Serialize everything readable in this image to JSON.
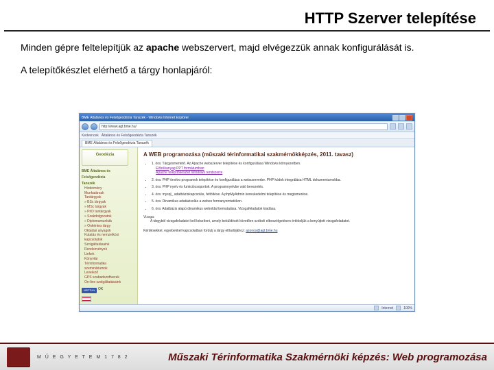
{
  "title": "HTTP Szerver telepítése",
  "para1_pre": "Minden gépre feltelepítjük az ",
  "para1_bold": "apache",
  "para1_post": " webszervert, majd elvégezzük annak konfigurálását is.",
  "para2": "A telepítőkészlet elérhető a tárgy honlapjáról:",
  "browser": {
    "window_title": "BME Általános és Felsőgeodézia Tanszék - Windows Internet Explorer",
    "address": "http://www.agt.bme.hu/",
    "tab_label": "BME Általános és Felsőgeodézia Tanszék",
    "linkbar": {
      "a": "Kedvencek",
      "b": "Általános és Felsőgeodézia Tanszék"
    },
    "sidebar": {
      "logo_top": "Geodézia",
      "head1": "BME Általános és",
      "head2": "Felsőgeodézia",
      "head3": "Tanszék",
      "menu1": "Hirdetmény",
      "menu2": "Munkatársak",
      "menu3": "Tantárgyak",
      "m3a": "» BSc tárgyak",
      "m3b": "» MSc tárgyak",
      "m3c": "» PhD tantárgyak",
      "m3d": "» Szakdolgozatok",
      "m3e": "» Diplomamunkák",
      "m3f": "» Önkéntes tárgy",
      "menu4": "Oktatási anyagok",
      "menu5": "Kutatás és nemzetközi",
      "menu6": "kapcsolatok",
      "menu7": "Szolgáltatásaink",
      "menu8": "Rendezvények",
      "menu9": "Linkek",
      "menu10": "Könyvtár",
      "menu11": "Térinformatika",
      "menu12": "szemináriumok",
      "menu13": "Levelező",
      "menu14": "GPS szabadszoftverek",
      "menu15": "On-line szolgáltatásaink",
      "badge": "NEPTUN",
      "ok": "OK"
    },
    "page": {
      "heading": "A WEB programozása (műszaki térinformatikai szakmérnökképzés, 2011. tavasz)",
      "li1": "1. óra: Tárgyismertető. Az Apache webszerver telepítése és konfigurálása Windows környezetben.",
      "li1a": "Előzékanyag PPT formátumban",
      "li1b": "Apache telepítőkészlet Windows rendszerre",
      "li2": "2. óra: PHP önvitro programok telepítése és konfigurálása a webszerverbe. PHP kódok integrálása HTML dokumentumokba.",
      "li3": "3. óra: PHP nyelv és funkciócsoportok. A programnyelvbe való bevezetés.",
      "li4": "4. óra: mysql_ adatbáziskapcsolás, feltöltése. A phpMyAdmin kereskedelmi telepítése és megismerése.",
      "li5": "5. óra: Dinamikus adatázisolás a webes formanyomtatókon.",
      "li6": "6. óra: Adatbázis alapú dinamikus weboldal bemutatása. Vizsgafeladatok kiadása.",
      "vizsga": "Vizsga:",
      "vizsga_detail": "A tárgyból vizsgafeladatot kell készíteni, amely beküldését követően szóbeli elbeszélgetésen értékeljük a benyújtott vizsgafeladatot.",
      "contact_pre": "Kérdésekkel, egyebekkel kapcsolatban fordulj a tárgy előadójához: ",
      "email": "azonos@agt.bme.hu"
    },
    "status": {
      "zone": "Internet",
      "zoom": "100%"
    }
  },
  "footer": {
    "university": "M Ű E G Y E T E M   1 7 8 2",
    "course": "Műszaki Térinformatika Szakmérnöki képzés: Web programozása"
  }
}
